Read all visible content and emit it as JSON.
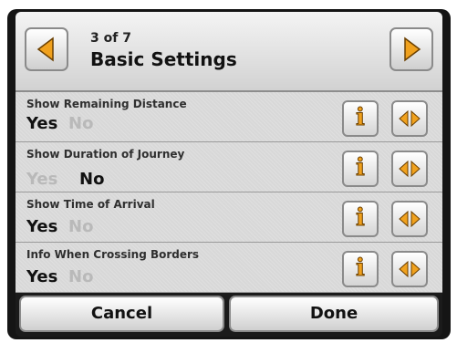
{
  "header": {
    "page_counter": "3 of 7",
    "title": "Basic Settings",
    "prev_icon": "arrow-left",
    "next_icon": "arrow-right"
  },
  "settings": [
    {
      "label": "Show Remaining Distance",
      "yes": "Yes",
      "no": "No",
      "selected": "yes"
    },
    {
      "label": "Show Duration of Journey",
      "yes": "Yes",
      "no": "No",
      "selected": "no"
    },
    {
      "label": "Show Time of Arrival",
      "yes": "Yes",
      "no": "No",
      "selected": "yes"
    },
    {
      "label": "Info When Crossing Borders",
      "yes": "Yes",
      "no": "No",
      "selected": "yes"
    }
  ],
  "info_glyph": "i",
  "footer": {
    "cancel_label": "Cancel",
    "done_label": "Done"
  },
  "colors": {
    "accent": "#f0a11d",
    "selected_text": "#111111",
    "unselected_text": "#b9b9b9"
  }
}
